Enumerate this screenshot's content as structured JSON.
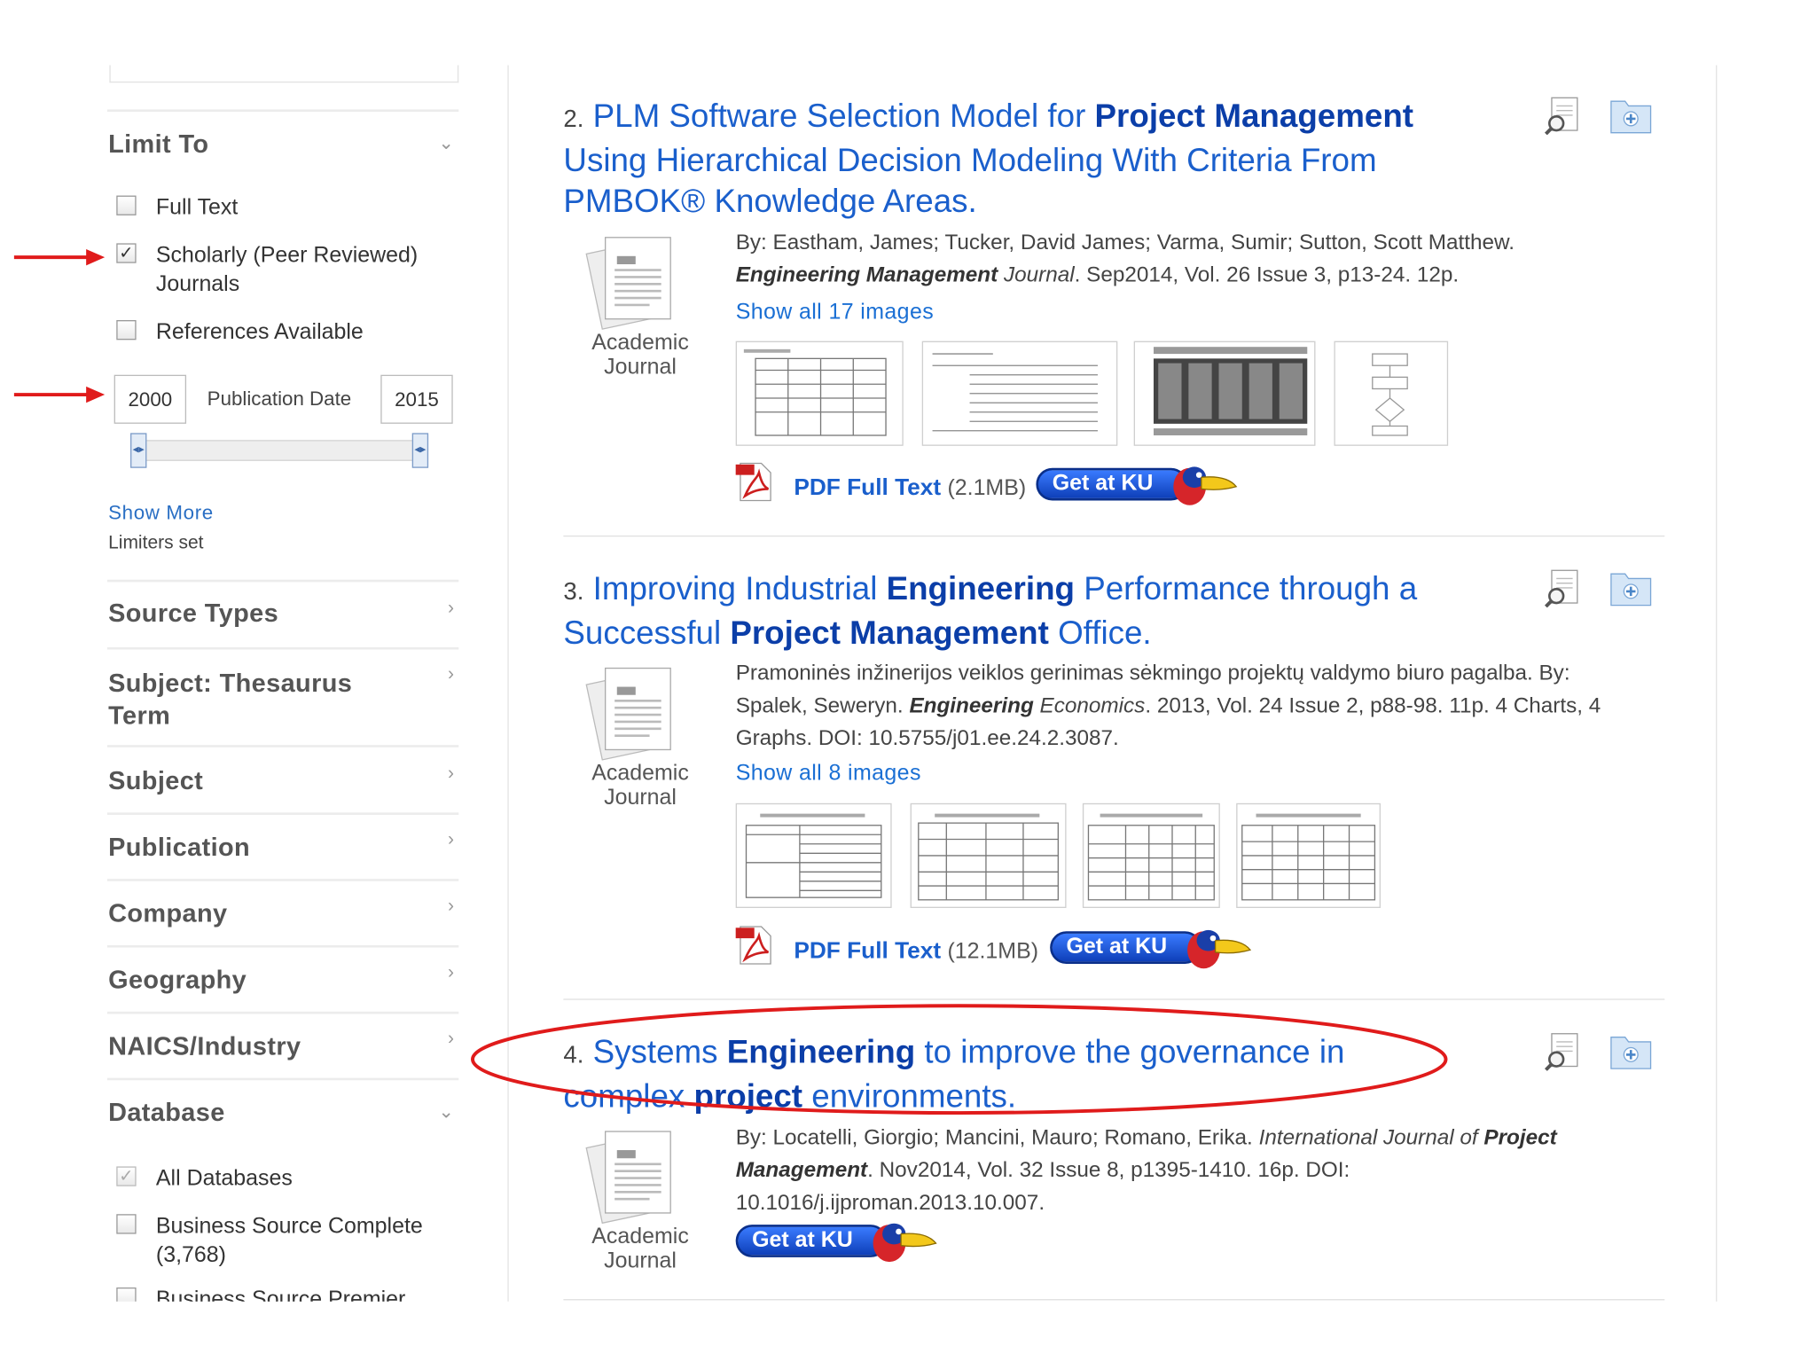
{
  "sidebar": {
    "limit_to": {
      "heading": "Limit To",
      "options": [
        {
          "label": "Full Text",
          "checked": false
        },
        {
          "label": "Scholarly (Peer Reviewed) Journals",
          "line1": "Scholarly (Peer Reviewed)",
          "line2": "Journals",
          "checked": true
        },
        {
          "label": "References Available",
          "checked": false
        }
      ],
      "date_from": "2000",
      "date_to": "2015",
      "date_label": "Publication Date",
      "show_more": "Show More",
      "limiters_set": "Limiters set"
    },
    "facets": [
      {
        "label": "Source Types"
      },
      {
        "label": "Subject: Thesaurus Term",
        "line1": "Subject: Thesaurus",
        "line2": "Term"
      },
      {
        "label": "Subject"
      },
      {
        "label": "Publication"
      },
      {
        "label": "Company"
      },
      {
        "label": "Geography"
      },
      {
        "label": "NAICS/Industry"
      }
    ],
    "database": {
      "heading": "Database",
      "options": [
        {
          "label": "All Databases",
          "checked": true
        },
        {
          "label": "Business Source Complete",
          "count": "(3,768)",
          "checked": false
        },
        {
          "label": "Business Source Premier",
          "checked": false
        }
      ]
    }
  },
  "results": [
    {
      "number": "2.",
      "title_parts": [
        "PLM Software Selection Model for ",
        "Project Management",
        "Using Hierarchical Decision Modeling With Criteria From",
        "PMBOK® Knowledge Areas."
      ],
      "doc_type": [
        "Academic",
        "Journal"
      ],
      "byline": "By: Eastham, James; Tucker, David James; Varma, Sumir; Sutton, Scott Matthew.",
      "source_bold": "Engineering Management",
      "source_rest": " Journal",
      "details": ". Sep2014, Vol. 26 Issue 3, p13-24. 12p.",
      "show_images": "Show all 17 images",
      "pdf_label": "PDF Full Text",
      "pdf_size": "(2.1MB)",
      "getku": "Get at KU"
    },
    {
      "number": "3.",
      "title_parts": [
        "Improving Industrial ",
        "Engineering",
        " Performance through a",
        "Successful ",
        "Project Management",
        " Office."
      ],
      "doc_type": [
        "Academic",
        "Journal"
      ],
      "line1": "Pramoninės inžinerijos veiklos gerinimas sėkmingo projektų valdymo biuro pagalba. By:",
      "line2_pre": "Spalek, Seweryn. ",
      "source_bold": "Engineering",
      "source_rest": " Economics",
      "line2_post": ". 2013, Vol. 24 Issue 2, p88-98. 11p. 4 Charts, 4",
      "line3": "Graphs. DOI: 10.5755/j01.ee.24.2.3087.",
      "show_images": "Show all 8 images",
      "pdf_label": "PDF Full Text",
      "pdf_size": "(12.1MB)",
      "getku": "Get at KU"
    },
    {
      "number": "4.",
      "title_parts": [
        "Systems ",
        "Engineering",
        " to improve the governance in",
        "complex ",
        "project",
        " environments."
      ],
      "doc_type": [
        "Academic",
        "Journal"
      ],
      "line1_pre": "By: Locatelli, Giorgio; Mancini, Mauro; Romano, Erika. ",
      "line1_italic": "International Journal of ",
      "line1_bold": "Project",
      "line2_bold": "Management",
      "line2_post": ". Nov2014, Vol. 32 Issue 8, p1395-1410. 16p. DOI:",
      "line3": "10.1016/j.ijproman.2013.10.007.",
      "getku": "Get at KU"
    }
  ],
  "colors": {
    "link": "#1a5fcc",
    "link_bold": "#0b3ea8",
    "annotation_red": "#e01b1b",
    "getku_blue": "#1f56d8"
  }
}
